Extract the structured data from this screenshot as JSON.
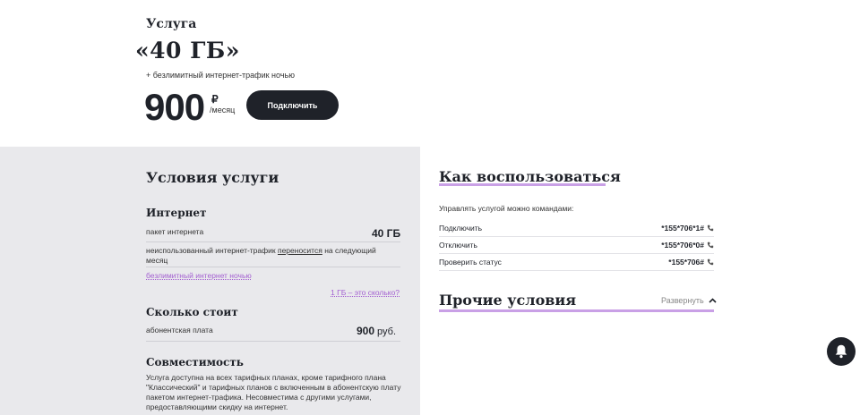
{
  "hero": {
    "kicker": "Услуга",
    "title": "«40 ГБ»",
    "subtitle": "+ безлимитный интернет-трафик ночью",
    "price": "900",
    "currency": "₽",
    "period": "/месяц",
    "connect_label": "Подключить"
  },
  "conditions": {
    "title": "Условия услуги",
    "internet": {
      "title": "Интернет",
      "package_label": "пакет интернета",
      "package_value": "40 ГБ",
      "rollover_before": "неиспользованный интернет-трафик ",
      "rollover_link": "переносится",
      "rollover_after": " на следующий месяц",
      "night_link": "безлимитный интернет ночью",
      "gb_link": "1 ГБ – это сколько?"
    },
    "cost": {
      "title": "Сколько стоит",
      "fee_label": "абонентская плата",
      "fee_value": "900",
      "fee_unit": "руб."
    },
    "compat": {
      "title": "Совместимость",
      "text": "Услуга доступна на всех тарифных планах, кроме тарифного плана \"Классический\" и тарифных планов с включенным в абонентскую плату пакетом интернет-трафика. Несовместима с другими услугами, предоставляющими скидку на интернет."
    }
  },
  "how": {
    "title": "Как воспользоваться",
    "hint": "Управлять услугой можно командами:",
    "commands": [
      {
        "label": "Подключить",
        "code": "*155*706*1#"
      },
      {
        "label": "Отключить",
        "code": "*155*706*0#"
      },
      {
        "label": "Проверить статус",
        "code": "*155*706#"
      }
    ]
  },
  "other": {
    "title": "Прочие условия",
    "expand_label": "Развернуть"
  },
  "icons": {
    "phone": "phone-icon",
    "chevron": "chevron-up-icon",
    "bell": "bell-icon"
  },
  "colors": {
    "accent": "#c9a0e6",
    "dark": "#1f2229",
    "panel": "#e9e9ec"
  }
}
